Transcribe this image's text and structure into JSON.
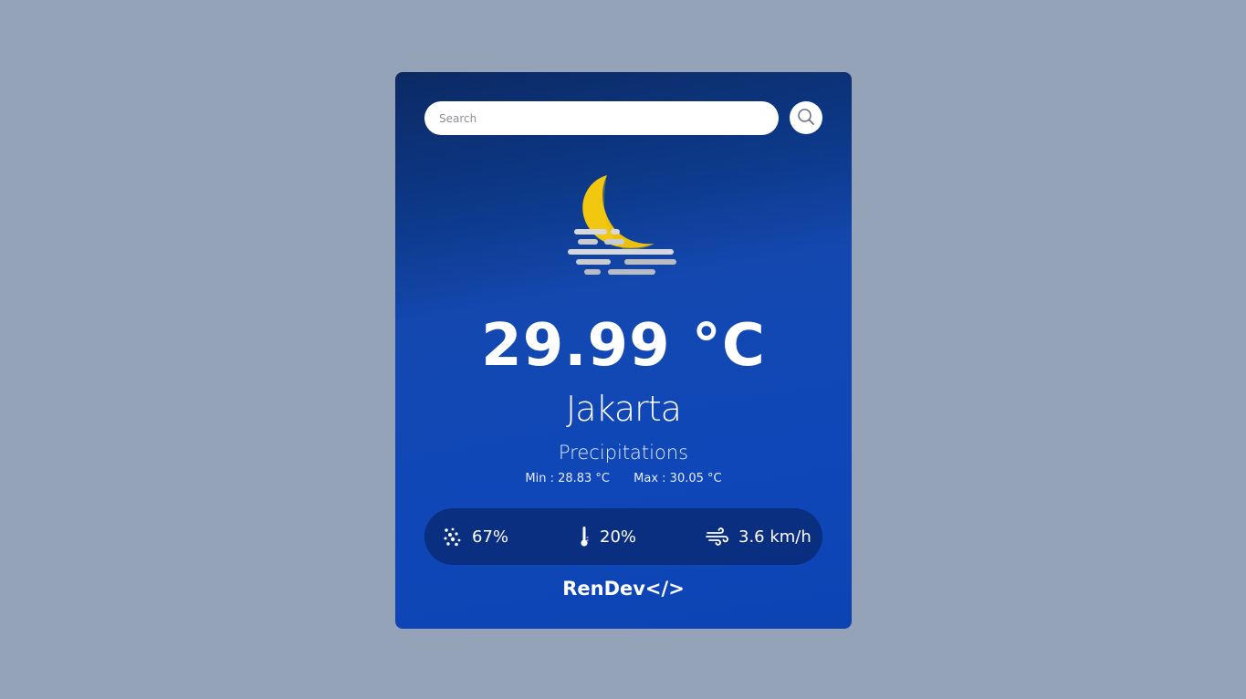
{
  "search": {
    "placeholder": "Search",
    "value": ""
  },
  "weather": {
    "icon": "moon-fog-icon",
    "temperature": "29.99 °C",
    "city": "Jakarta",
    "condition": "Precipitations",
    "min": "Min : 28.83 °C",
    "max": "Max : 30.05 °C"
  },
  "stats": {
    "humidity": {
      "icon": "humidity-icon",
      "value": "67%"
    },
    "precipitation": {
      "icon": "thermometer-icon",
      "value": "20%"
    },
    "wind": {
      "icon": "wind-icon",
      "value": "3.6 km/h"
    }
  },
  "brand": "RenDev</>",
  "colors": {
    "page_background": "#94a3b8",
    "card_gradient_top": "#0b2a63",
    "card_gradient_bottom": "#0c44b4",
    "moon": "#f2c70f",
    "fog": "#c9ccd1"
  }
}
